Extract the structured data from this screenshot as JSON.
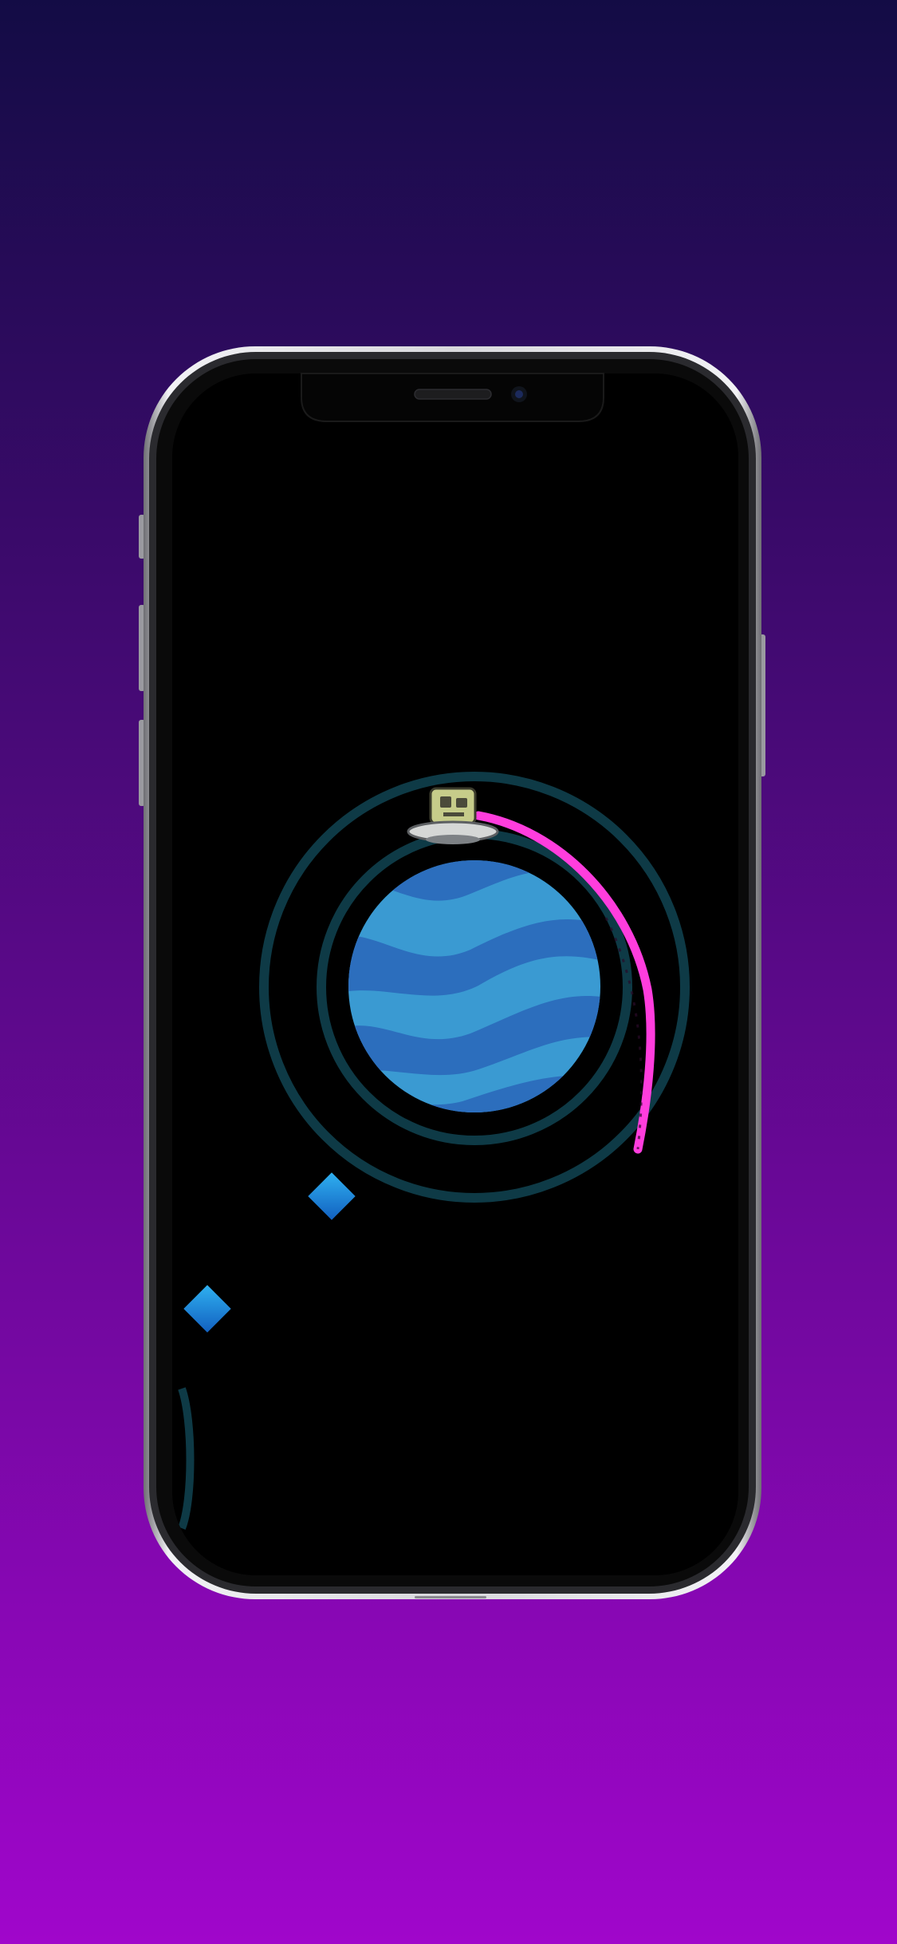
{
  "background": {
    "gradient_top": "#130c45",
    "gradient_bottom": "#a006cb"
  },
  "device": {
    "frame_color": "#b9b9be",
    "bezel_color": "#0a0a0a",
    "screen_color": "#000000"
  },
  "game": {
    "orbit_ring_color": "#0e3a46",
    "planet": {
      "base_color": "#3a9ad2",
      "wave_color": "#2c6ebd"
    },
    "player": {
      "name": "ufo-robot",
      "dome_color": "#c6cc8a",
      "saucer_color": "#d5d7d6"
    },
    "trail_color": "#ff3ddd",
    "gems": [
      {
        "id": "gem-1",
        "color": "#1e8ad9"
      },
      {
        "id": "gem-2",
        "color": "#1e8ad9"
      }
    ]
  }
}
